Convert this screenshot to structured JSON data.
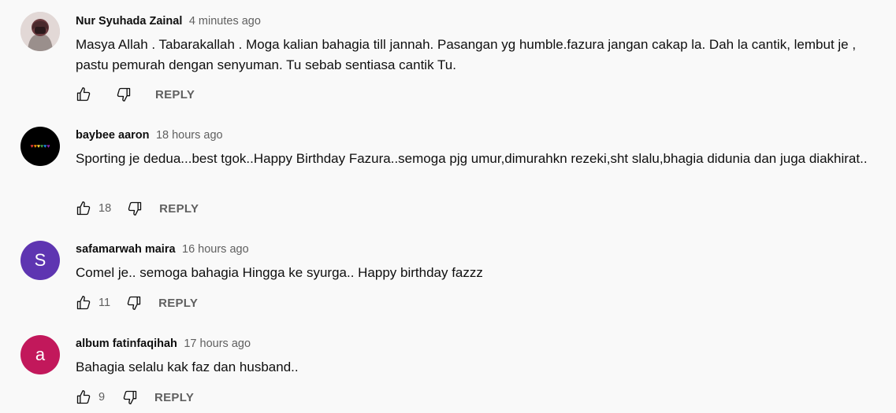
{
  "comments": [
    {
      "author": "Nur Syuhada Zainal",
      "time": "4 minutes ago",
      "text": "Masya Allah . Tabarakallah . Moga kalian bahagia till jannah. Pasangan yg humble.fazura jangan cakap la. Dah la cantik, lembut je , pastu pemurah dengan senyuman. Tu sebab sentiasa cantik Tu.",
      "likes": "",
      "reply": "REPLY",
      "avatar": {
        "type": "photo",
        "color": "#d8cfcd"
      }
    },
    {
      "author": "baybee aaron",
      "time": "18 hours ago",
      "text": "Sporting je dedua...best tgok..Happy Birthday Fazura..semoga pjg umur,dimurahkn rezeki,sht slalu,bhagia didunia dan juga diakhirat..",
      "likes": "18",
      "reply": "REPLY",
      "avatar": {
        "type": "hearts",
        "color": "#000000"
      }
    },
    {
      "author": "safamarwah maira",
      "time": "16 hours ago",
      "text": "Comel je.. semoga bahagia Hingga ke syurga.. Happy birthday fazzz",
      "likes": "11",
      "reply": "REPLY",
      "avatar": {
        "type": "letter",
        "letter": "S",
        "color": "#5e35b1"
      }
    },
    {
      "author": "album fatinfaqihah",
      "time": "17 hours ago",
      "text": "Bahagia selalu kak faz dan husband..",
      "likes": "9",
      "reply": "REPLY",
      "avatar": {
        "type": "letter",
        "letter": "a",
        "color": "#c2185b"
      }
    }
  ],
  "icons": {
    "like": "thumbs-up-icon",
    "dislike": "thumbs-down-icon"
  },
  "colors": {
    "background": "#f9f9f9",
    "secondary_text": "#606060"
  }
}
